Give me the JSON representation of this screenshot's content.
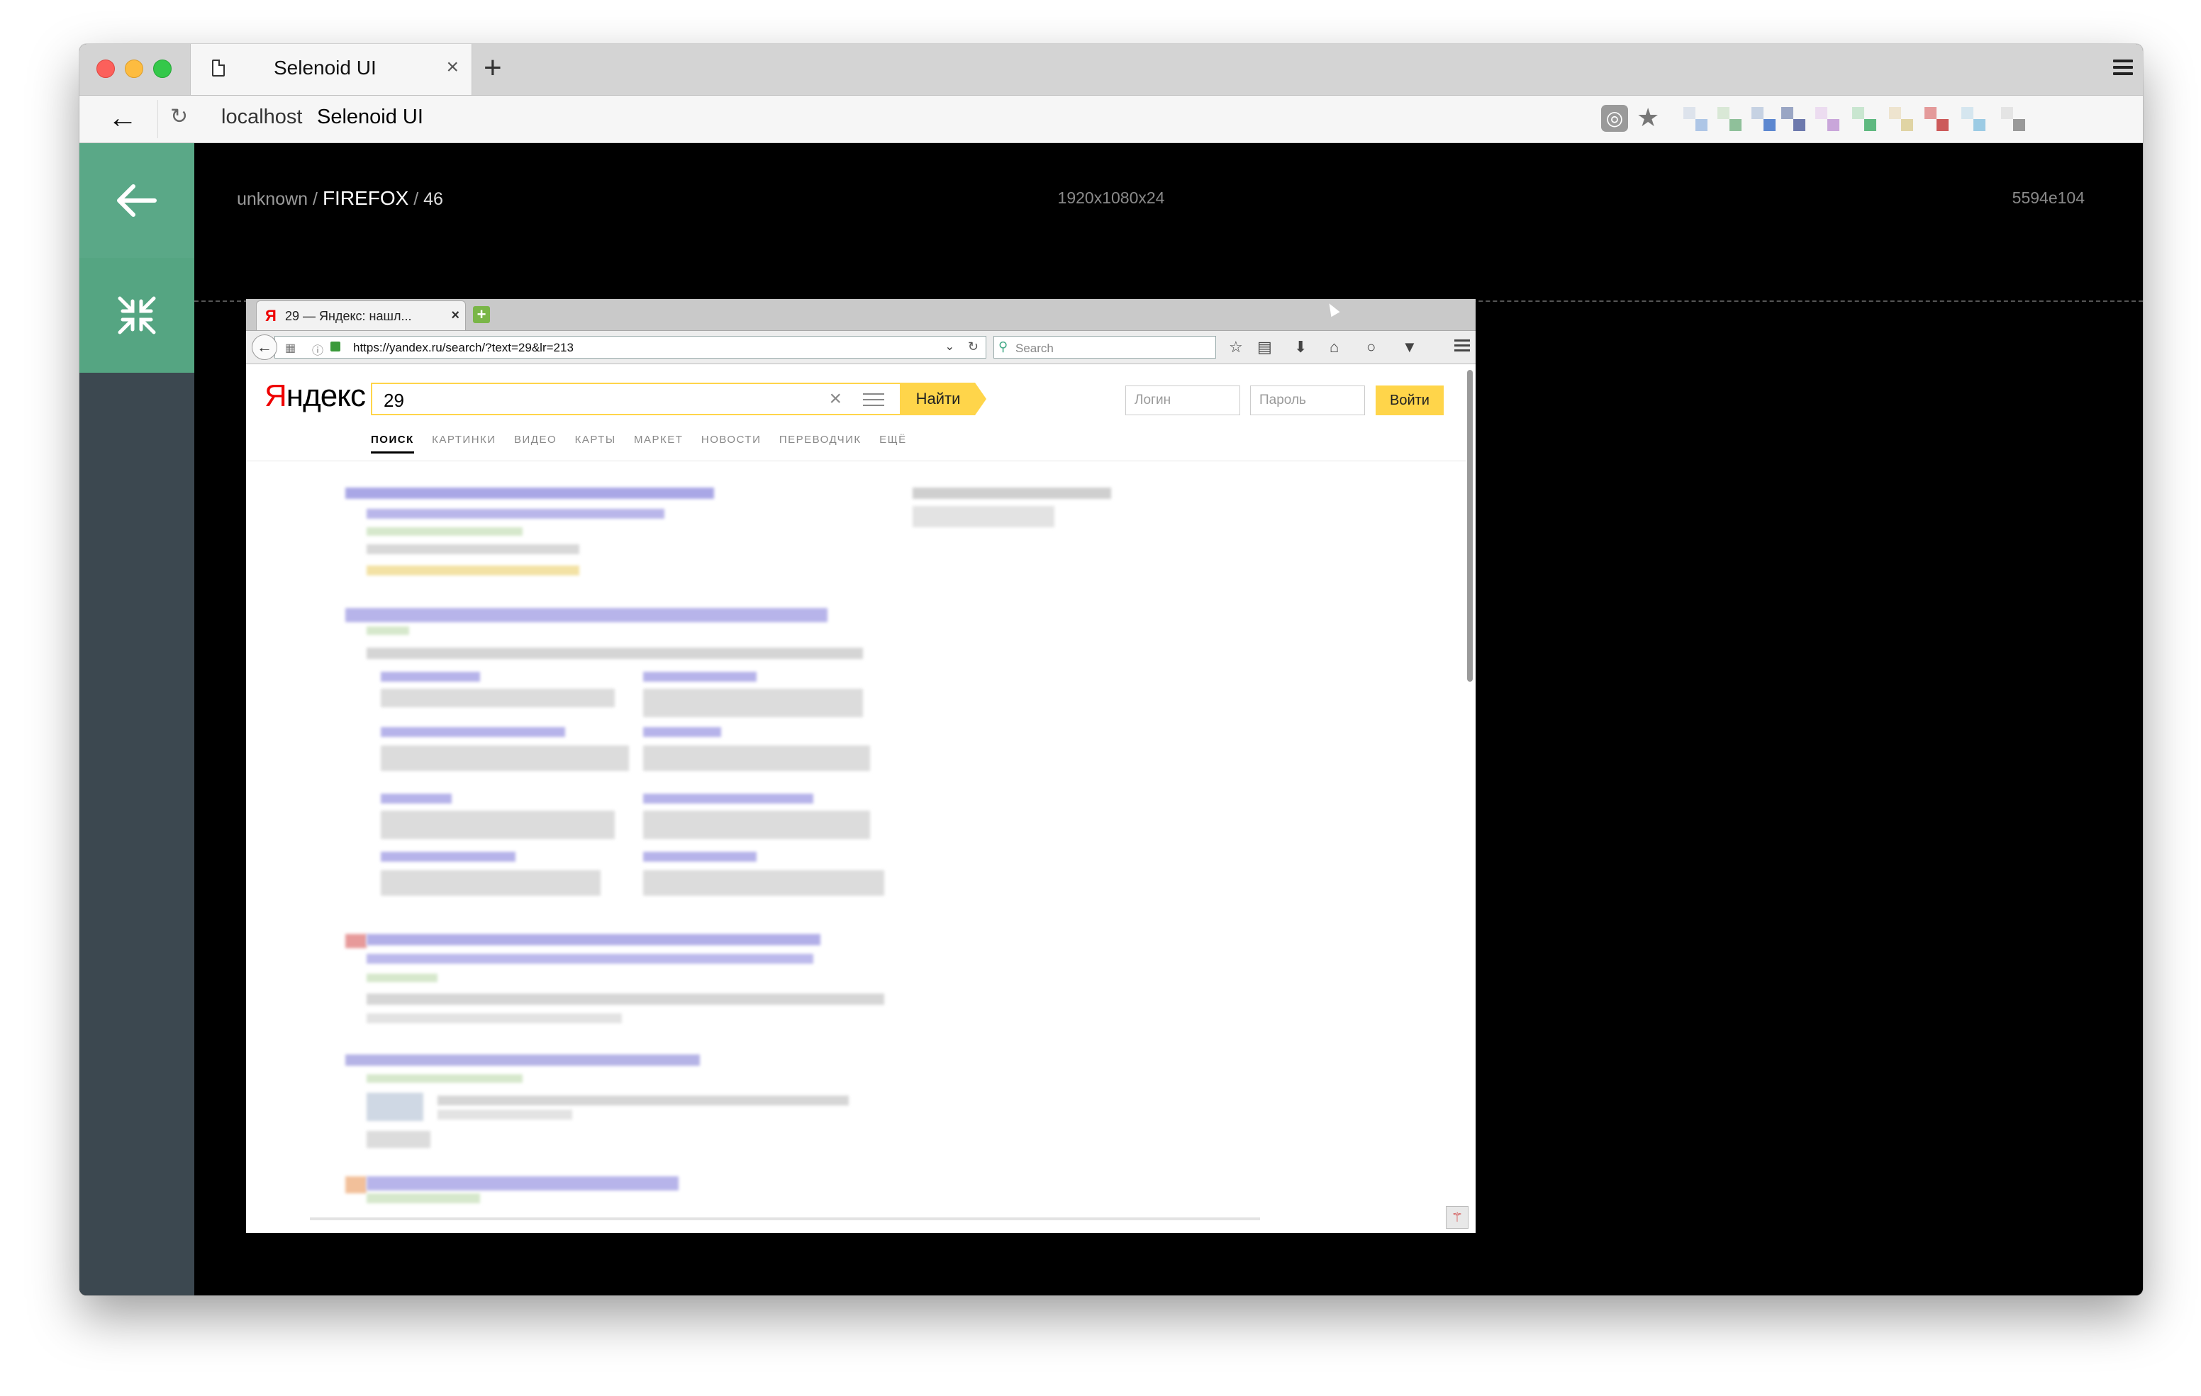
{
  "window": {
    "tab_title": "Selenoid UI",
    "tab_close": "×",
    "new_tab": "+",
    "url_host": "localhost",
    "url_title": "Selenoid UI"
  },
  "session": {
    "platform": "unknown",
    "browser": "FIREFOX",
    "version": "46",
    "resolution": "1920x1080x24",
    "session_id": "5594e104"
  },
  "vnc": {
    "tab_title": "29 — Яндекс: нашл...",
    "tab_close": "×",
    "url": "https://yandex.ru/search/?text=29&lr=213",
    "search_placeholder": "Search",
    "yandex": {
      "logo_first": "Я",
      "logo_rest": "ндекс",
      "query": "29",
      "find_button": "Найти",
      "login_placeholder": "Логин",
      "password_placeholder": "Пароль",
      "enter_button": "Войти",
      "tabs": [
        "ПОИСК",
        "КАРТИНКИ",
        "ВИДЕО",
        "КАРТЫ",
        "МАРКЕТ",
        "НОВОСТИ",
        "ПЕРЕВОДЧИК",
        "ЕЩЁ"
      ]
    }
  },
  "colors": {
    "sidebar": "#3c4850",
    "sidebar_button": "#5aa887",
    "yandex_yellow": "#ffd54a"
  }
}
